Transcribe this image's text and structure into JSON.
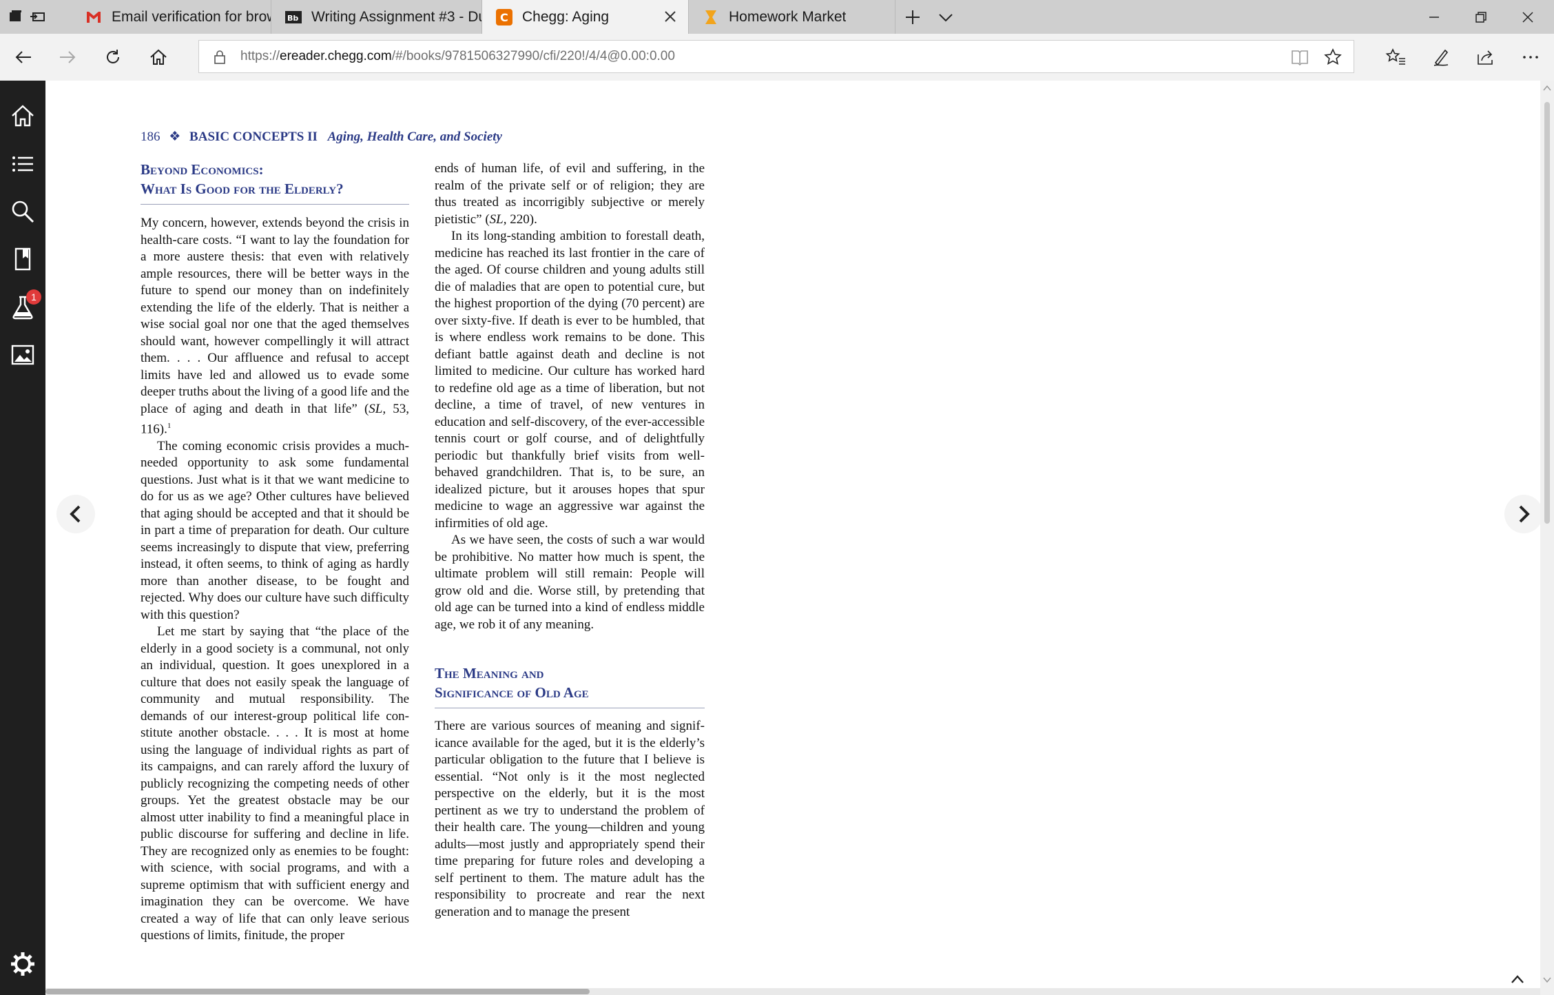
{
  "tabs": [
    {
      "title": "Email verification for brown",
      "favicon": "gmail-icon"
    },
    {
      "title": "Writing Assignment #3 - Du",
      "favicon": "blackboard-icon"
    },
    {
      "title": "Chegg: Aging",
      "favicon": "chegg-icon",
      "active": true
    },
    {
      "title": "Homework Market",
      "favicon": "homework-market-icon"
    }
  ],
  "addressbar": {
    "scheme": "https://",
    "host": "ereader.chegg.com",
    "path": "/#/books/9781506327990/cfi/220!/4/4@0.00:0.00"
  },
  "sidebar": {
    "items": [
      "home-icon",
      "contents-list-icon",
      "search-icon",
      "bookmark-icon",
      "flashcards-icon",
      "images-icon",
      "settings-icon"
    ],
    "badge_count": "1"
  },
  "page": {
    "number": "186",
    "separator": "❖",
    "part": "BASIC CONCEPTS II",
    "book_title": "Aging, Health Care, and Society",
    "section1_heading_line1": "Beyond Economics:",
    "section1_heading_line2": "What Is Good for the Elderly?",
    "section2_heading_line1": "The Meaning and",
    "section2_heading_line2": "Significance of Old Age",
    "left_p1_a": "My concern, however, extends beyond the crisis in health-care costs. “I want to lay the founda­tion for a more austere thesis: that even with relatively ample resources, there will be better ways in the future to spend our money than on indefinitely extending the life of the elderly. That is neither a wise social goal nor one that the aged themselves should want, however com­pellingly it will attract them. . . . Our affluence and refusal to accept limits have led and allowed us to evade some deeper truths about the living of a good life and the place of aging and death in that life” (",
    "left_p1_cite": "SL,",
    "left_p1_b": " 53, 116).",
    "left_p1_note": "1",
    "left_p2": "The coming economic crisis provides a much-needed opportunity to ask some funda­mental questions. Just what is it that we want medicine to do for us as we age? Other cultures have believed that aging should be accepted and that it should be in part a time of preparation for death. Our culture seems increasingly to dispute that view, preferring instead, it often seems, to think of aging as hardly more than another dis­ease, to be fought and rejected. Why does our culture have such difficulty with this question?",
    "left_p3": "Let me start by saying that “the place of the elderly in a good society is a communal, not only an individual, question. It goes unexplored in a culture that does not easily speak the language of community and mutual responsibility. The demands of our interest-group political life con­stitute another obstacle. . . . It is most at home using the language of individual rights as part of its campaigns, and can rarely afford the luxury of publicly recognizing the competing needs of other groups. Yet the greatest obstacle may be our almost utter inability to find a meaningful place in public discourse for suffering and decline in life. They are recognized only as enemies to be fought: with science, with social programs, and with a supreme optimism that with sufficient energy and imagination they can be overcome. We have created a way of life that can only leave serious questions of limits, finitude, the proper",
    "right_p1_a": "ends of human life, of evil and suffering, in the realm of the private self or of religion; they are thus treated as incorrigibly subjective or merely pietistic” (",
    "right_p1_cite": "SL,",
    "right_p1_b": " 220).",
    "right_p2": "In its long-standing ambition to forestall death, medicine has reached its last frontier in the care of the aged. Of course children and young adults still die of maladies that are open to potential cure, but the highest proportion of the dying (70 percent) are over sixty-five. If death is ever to be humbled, that is where end­less work remains to be done. This defiant battle against death and decline is not limited to med­icine. Our culture has worked hard to redefine old age as a time of liberation, but not decline, a time of travel, of new ventures in education and self-discovery, of the ever-accessible tennis court or golf course, and of delightfully periodic but thankfully brief visits from well-behaved grandchildren. That is, to be sure, an idealized picture, but it arouses hopes that spur medicine to wage an aggressive war against the infirmi­ties of old age.",
    "right_p3": "As we have seen, the costs of such a war would be prohibitive. No matter how much is spent, the ultimate problem will still remain: People will grow old and die. Worse still, by pretending that old age can be turned into a kind of endless middle age, we rob it of any meaning.",
    "right_p4": "There are various sources of meaning and signif­icance available for the aged, but it is the elder­ly’s particular obligation to the future that I believe is essential. “Not only is it the most neglected perspective on the elderly, but it is the most pertinent as we try to understand the prob­lem of their health care. The young—children and young adults—most justly and appropriately spend their time preparing for future roles and developing a self pertinent to them. The mature adult has the responsibility to procreate and rear the next generation and to manage the present"
  },
  "colors": {
    "accent_blue": "#2b3a86",
    "sidebar_bg": "#1f1f1f",
    "tabstrip_bg": "#cfcfcf",
    "chegg_orange": "#eb7100",
    "gmail_red": "#d93025",
    "badge_red": "#e03a3a"
  }
}
